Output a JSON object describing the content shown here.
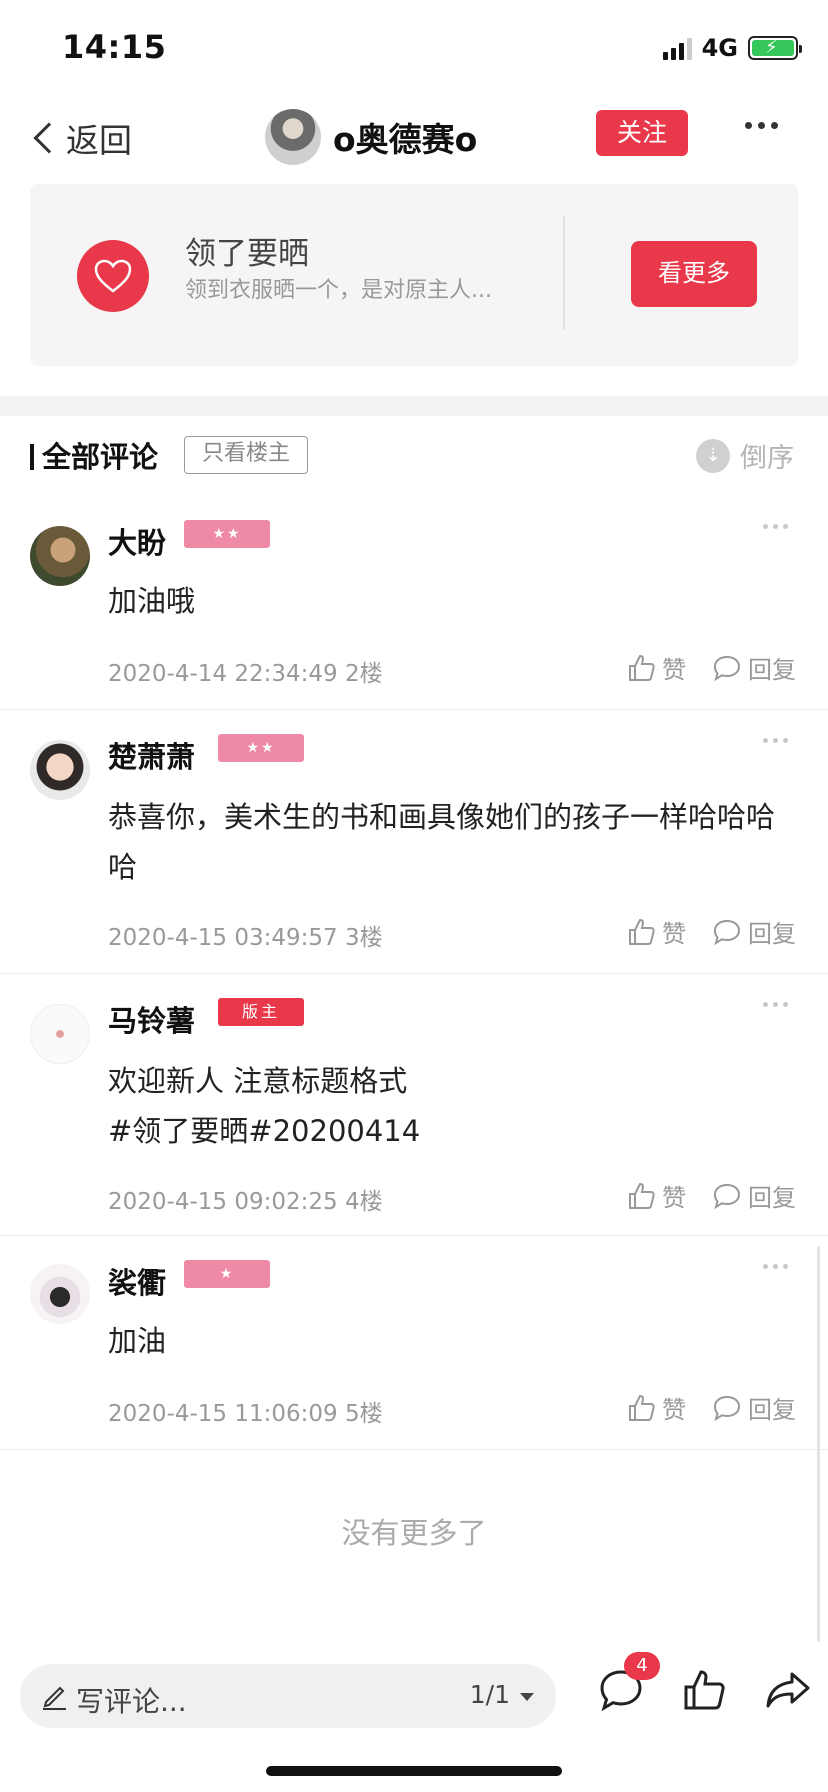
{
  "status_bar": {
    "time": "14:15",
    "network": "4G"
  },
  "nav": {
    "back_label": "返回",
    "username": "o奥德赛o",
    "follow_label": "关注"
  },
  "topic": {
    "title": "领了要晒",
    "description": "领到衣服晒一个，是对原主人...",
    "see_more_label": "看更多"
  },
  "comments_header": {
    "title": "全部评论",
    "owner_only_label": "只看楼主",
    "sort_label": "倒序"
  },
  "comments": [
    {
      "name": "大盼",
      "badge": "★★",
      "badge_type": "level",
      "text": "加油哦",
      "time": "2020-4-14 22:34:49",
      "floor": "2楼",
      "like_label": "赞",
      "reply_label": "回复"
    },
    {
      "name": "楚萧萧",
      "badge": "★★",
      "badge_type": "level",
      "text": "恭喜你，美术生的书和画具像她们的孩子一样哈哈哈哈",
      "time": "2020-4-15 03:49:57",
      "floor": "3楼",
      "like_label": "赞",
      "reply_label": "回复"
    },
    {
      "name": "马铃薯",
      "badge": "版主",
      "badge_type": "moderator",
      "text_line1": "欢迎新人 注意标题格式",
      "text_line2": "#领了要晒#20200414",
      "time": "2020-4-15 09:02:25",
      "floor": "4楼",
      "like_label": "赞",
      "reply_label": "回复"
    },
    {
      "name": "裟衢",
      "badge": "★",
      "badge_type": "level",
      "text": "加油",
      "time": "2020-4-15 11:06:09",
      "floor": "5楼",
      "like_label": "赞",
      "reply_label": "回复"
    }
  ],
  "footer_text": "没有更多了",
  "bottom_bar": {
    "placeholder": "写评论...",
    "page_indicator": "1/1",
    "comment_count": "4"
  },
  "colors": {
    "accent": "#e8384a",
    "badge_pink": "#ef8aa6",
    "muted_text": "#999999"
  },
  "icons": [
    "back-chevron-icon",
    "more-icon",
    "heart-icon",
    "sort-icon",
    "like-icon",
    "reply-icon",
    "pen-icon",
    "comment-icon",
    "thumbs-up-icon",
    "share-icon"
  ]
}
